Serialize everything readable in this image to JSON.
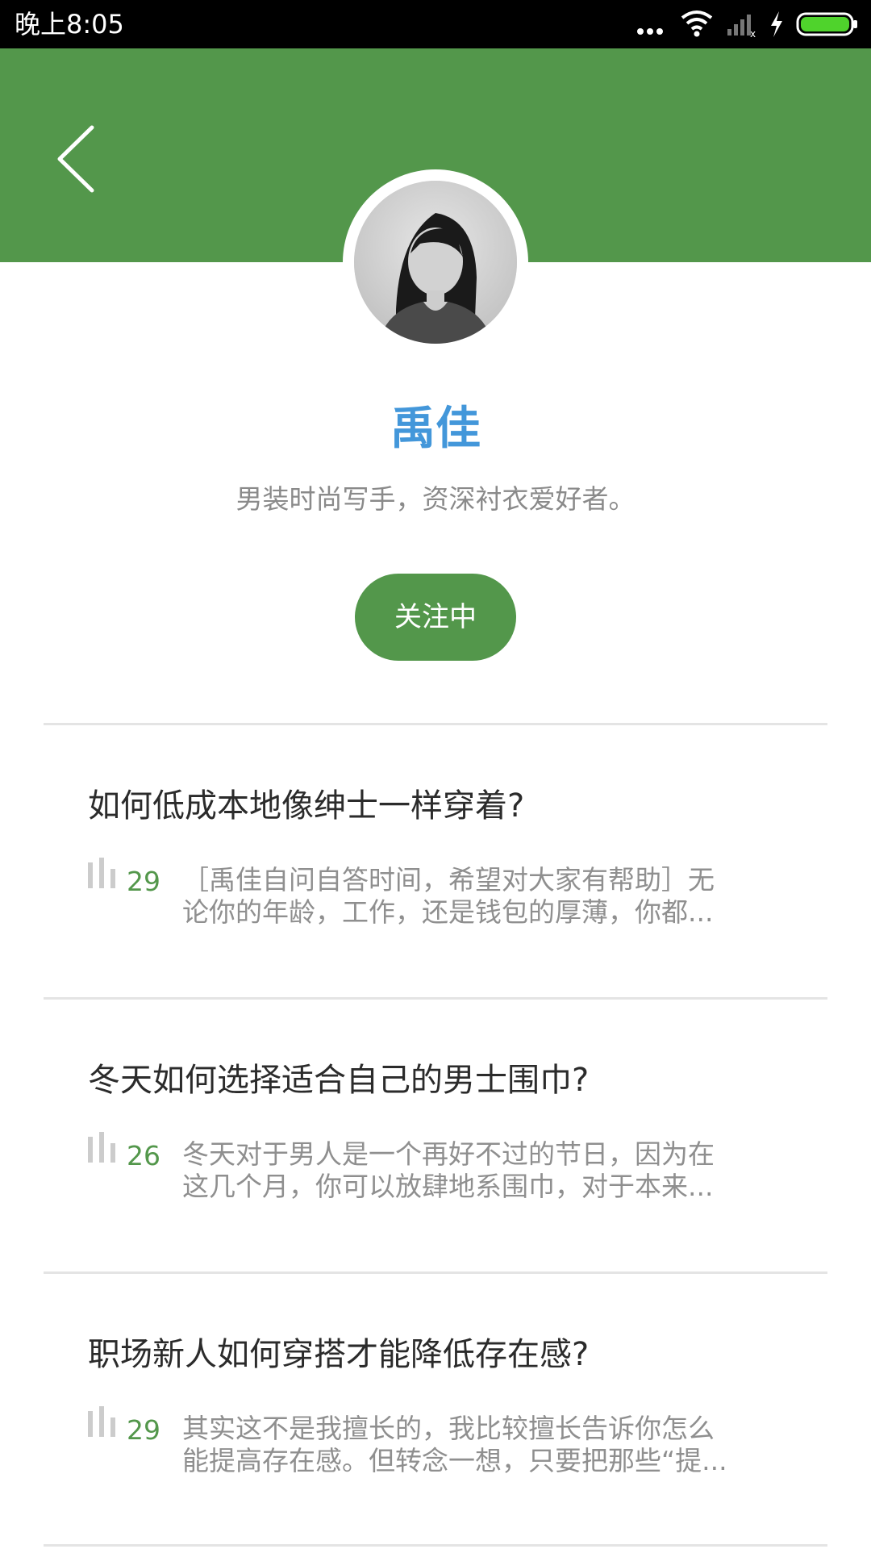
{
  "status_bar": {
    "time": "晚上8:05",
    "icons": [
      "more-dots-icon",
      "wifi-icon",
      "signal-icon",
      "charging-icon",
      "battery-icon"
    ],
    "battery_color": "#4fd32c"
  },
  "header": {
    "background_color": "#53974b",
    "back_icon": "back-chevron-icon"
  },
  "author": {
    "name": "禹佳",
    "bio": "男装时尚写手，资深衬衣爱好者。",
    "follow_label": "关注中",
    "name_color": "#4397da"
  },
  "articles": [
    {
      "title": "如何低成本地像绅士一样穿着?",
      "count": "29",
      "excerpt_line1": "［禹佳自问自答时间，希望对大家有帮助］无",
      "excerpt_line2": "论你的年龄，工作，还是钱包的厚薄，你都..."
    },
    {
      "title": "冬天如何选择适合自己的男士围巾?",
      "count": "26",
      "excerpt_line1": "冬天对于男人是一个再好不过的节日，因为在",
      "excerpt_line2": "这几个月，你可以放肆地系围巾，对于本来..."
    },
    {
      "title": "职场新人如何穿搭才能降低存在感?",
      "count": "29",
      "excerpt_line1": "其实这不是我擅长的，我比较擅长告诉你怎么",
      "excerpt_line2": "能提高存在感。但转念一想，只要把那些“提..."
    }
  ]
}
